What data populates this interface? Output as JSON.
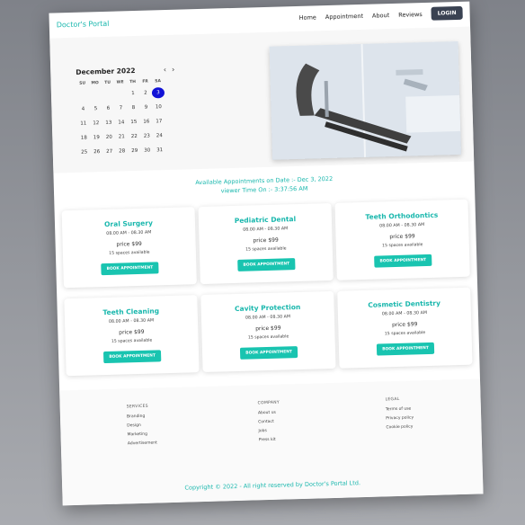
{
  "nav": {
    "brand": "Doctor's Portal",
    "links": [
      "Home",
      "Appointment",
      "About",
      "Reviews"
    ],
    "login": "LOGIN"
  },
  "calendar": {
    "title": "December 2022",
    "days_of_week": [
      "SU",
      "MO",
      "TU",
      "WE",
      "TH",
      "FR",
      "SA"
    ],
    "selected_day": "3",
    "weeks": [
      [
        "",
        "",
        "",
        "",
        "1",
        "2",
        "3"
      ],
      [
        "4",
        "5",
        "6",
        "7",
        "8",
        "9",
        "10"
      ],
      [
        "11",
        "12",
        "13",
        "14",
        "15",
        "16",
        "17"
      ],
      [
        "18",
        "19",
        "20",
        "21",
        "22",
        "23",
        "24"
      ],
      [
        "25",
        "26",
        "27",
        "28",
        "29",
        "30",
        "31"
      ]
    ]
  },
  "availability": {
    "line1": "Available Appointments on Date :- Dec 3, 2022",
    "line2": "viewer Time On :- 3:37:56 AM"
  },
  "cards": [
    {
      "title": "Oral Surgery",
      "time": "08.00 AM - 08.30 AM",
      "price": "price $99",
      "spaces": "15 spaces available",
      "button": "BOOK APPOINTMENT"
    },
    {
      "title": "Pediatric Dental",
      "time": "08.00 AM - 08.30 AM",
      "price": "price $99",
      "spaces": "15 spaces available",
      "button": "BOOK APPOINTMENT"
    },
    {
      "title": "Teeth Orthodontics",
      "time": "08.00 AM - 08.30 AM",
      "price": "price $99",
      "spaces": "15 spaces available",
      "button": "BOOK APPOINTMENT"
    },
    {
      "title": "Teeth Cleaning",
      "time": "08.00 AM - 08.30 AM",
      "price": "price $99",
      "spaces": "15 spaces available",
      "button": "BOOK APPOINTMENT"
    },
    {
      "title": "Cavity Protection",
      "time": "08.00 AM - 08.30 AM",
      "price": "price $99",
      "spaces": "15 spaces available",
      "button": "BOOK APPOINTMENT"
    },
    {
      "title": "Cosmetic Dentistry",
      "time": "08.00 AM - 08.30 AM",
      "price": "price $99",
      "spaces": "15 spaces available",
      "button": "BOOK APPOINTMENT"
    }
  ],
  "footer": {
    "services": {
      "heading": "SERVICES",
      "items": [
        "Branding",
        "Design",
        "Marketing",
        "Advertisement"
      ]
    },
    "company": {
      "heading": "COMPANY",
      "items": [
        "About us",
        "Contact",
        "Jobs",
        "Press kit"
      ]
    },
    "legal": {
      "heading": "LEGAL",
      "items": [
        "Terms of use",
        "Privacy policy",
        "Cookie policy"
      ]
    },
    "copyright": "Copyright © 2022 - All right reserved by Doctor's Portal Ltd."
  },
  "colors": {
    "accent": "#19b7ad",
    "button": "#19c4b0",
    "selected_day": "#1212d6",
    "login_bg": "#3a4252"
  }
}
